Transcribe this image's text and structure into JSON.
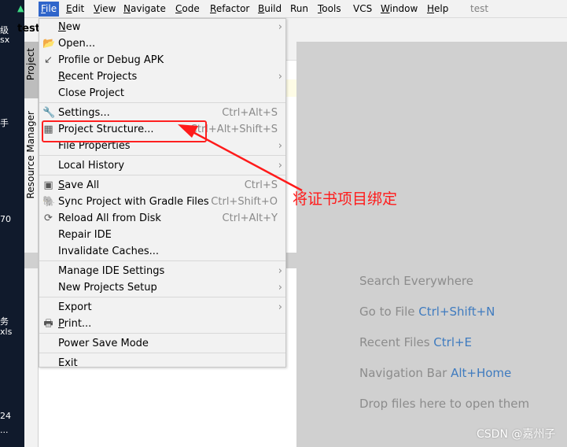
{
  "desktop": {
    "fragments": [
      "级",
      "sx",
      "手",
      "70",
      "务",
      "xls",
      "24",
      "..."
    ]
  },
  "menubar": {
    "items": [
      {
        "label": "File",
        "mn": "F",
        "active": true
      },
      {
        "label": "Edit",
        "mn": "E"
      },
      {
        "label": "View",
        "mn": "V"
      },
      {
        "label": "Navigate",
        "mn": "N"
      },
      {
        "label": "Code",
        "mn": "C"
      },
      {
        "label": "Refactor",
        "mn": "R"
      },
      {
        "label": "Build",
        "mn": "B"
      },
      {
        "label": "Run",
        "mn": "u"
      },
      {
        "label": "Tools",
        "mn": "T"
      },
      {
        "label": "VCS",
        "mn": "S"
      },
      {
        "label": "Window",
        "mn": "W"
      },
      {
        "label": "Help",
        "mn": "H"
      }
    ],
    "title": "test"
  },
  "breadcrumb": "test",
  "toolwindows": {
    "project": "Project",
    "resource_manager": "Resource Manager"
  },
  "file_menu": [
    {
      "label": "New",
      "mn": "N",
      "submenu": true
    },
    {
      "label": "Open...",
      "mn": "",
      "icon": "folder-open-icon",
      "glyph": "📂"
    },
    {
      "label": "Profile or Debug APK",
      "icon": "profile-apk-icon",
      "glyph": "↙"
    },
    {
      "label": "Recent Projects",
      "mn": "R",
      "submenu": true
    },
    {
      "label": "Close Project"
    },
    {
      "sep": true
    },
    {
      "label": "Settings...",
      "mn": "t",
      "icon": "wrench-icon",
      "glyph": "🔧",
      "shortcut": "Ctrl+Alt+S"
    },
    {
      "label": "Project Structure...",
      "icon": "project-structure-icon",
      "glyph": "▦",
      "shortcut": "Ctrl+Alt+Shift+S"
    },
    {
      "label": "File Properties",
      "submenu": true
    },
    {
      "sep": true
    },
    {
      "label": "Local History",
      "mn": "H",
      "submenu": true
    },
    {
      "sep": true
    },
    {
      "label": "Save All",
      "mn": "S",
      "icon": "save-icon",
      "glyph": "▣",
      "shortcut": "Ctrl+S"
    },
    {
      "label": "Sync Project with Gradle Files",
      "mn": "G",
      "icon": "gradle-sync-icon",
      "glyph": "🐘",
      "shortcut": "Ctrl+Shift+O"
    },
    {
      "label": "Reload All from Disk",
      "icon": "reload-icon",
      "glyph": "⟳",
      "shortcut": "Ctrl+Alt+Y"
    },
    {
      "label": "Repair IDE"
    },
    {
      "label": "Invalidate Caches..."
    },
    {
      "sep": true
    },
    {
      "label": "Manage IDE Settings",
      "submenu": true
    },
    {
      "label": "New Projects Setup",
      "submenu": true
    },
    {
      "sep": true
    },
    {
      "label": "Export",
      "submenu": true
    },
    {
      "label": "Print...",
      "mn": "P",
      "icon": "print-icon",
      "glyph": "🖶"
    },
    {
      "sep": true
    },
    {
      "label": "Power Save Mode"
    },
    {
      "sep": true
    },
    {
      "label": "Exit",
      "mn": "x"
    }
  ],
  "editor_hints": [
    {
      "text": "Search Everywhere",
      "key": ""
    },
    {
      "text": "Go to File ",
      "key": "Ctrl+Shift+N"
    },
    {
      "text": "Recent Files ",
      "key": "Ctrl+E"
    },
    {
      "text": "Navigation Bar ",
      "key": "Alt+Home"
    },
    {
      "text": "Drop files here to open them",
      "key": ""
    }
  ],
  "annotation": {
    "text": "将证书项目绑定",
    "color": "#ff1a1a"
  },
  "watermark": "CSDN @嘉州子",
  "colors": {
    "menu_active": "#2f65ca",
    "shortcut_blue": "#3f7bbf"
  }
}
